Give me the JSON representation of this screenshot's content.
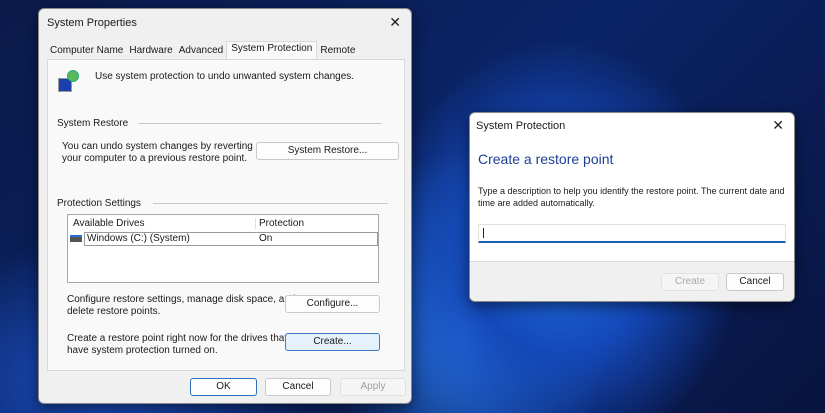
{
  "sysprops": {
    "title": "System Properties",
    "tabs": [
      "Computer Name",
      "Hardware",
      "Advanced",
      "System Protection",
      "Remote"
    ],
    "active_tab": "System Protection",
    "intro": "Use system protection to undo unwanted system changes.",
    "restore_group": "System Restore",
    "restore_text1": "You can undo system changes by reverting",
    "restore_text2": "your computer to a previous restore point.",
    "restore_button": "System Restore...",
    "protection_group": "Protection Settings",
    "columns": [
      "Available Drives",
      "Protection"
    ],
    "drives": [
      {
        "name": "Windows (C:) (System)",
        "protection": "On"
      }
    ],
    "configure_text1": "Configure restore settings, manage disk space, and",
    "configure_text2": "delete restore points.",
    "configure_button": "Configure...",
    "create_text1": "Create a restore point right now for the drives that",
    "create_text2": "have system protection turned on.",
    "create_button": "Create...",
    "ok": "OK",
    "cancel": "Cancel",
    "apply": "Apply"
  },
  "restore_dialog": {
    "title": "System Protection",
    "heading": "Create a restore point",
    "description": "Type a description to help you identify the restore point. The current date and time are added automatically.",
    "input_value": "",
    "create": "Create",
    "cancel": "Cancel"
  }
}
